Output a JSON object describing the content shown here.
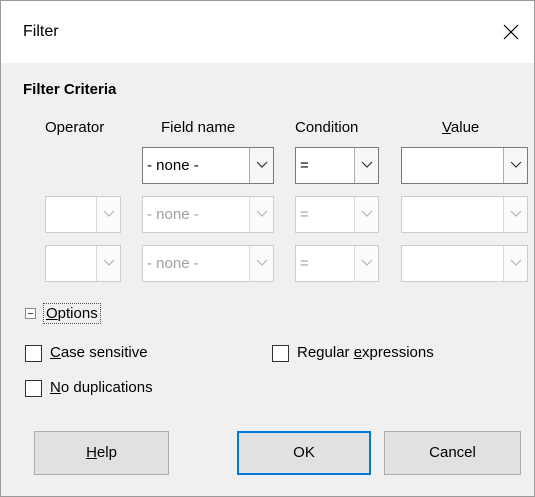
{
  "dialog": {
    "title": "Filter"
  },
  "criteria": {
    "section_title": "Filter Criteria",
    "headers": {
      "operator": "Operator",
      "field_name": "Field name",
      "condition": "Condition",
      "value_prefix": "",
      "value_mnemonic": "V",
      "value_rest": "alue"
    },
    "rows": [
      {
        "operator": "",
        "field": "- none -",
        "condition": "=",
        "value": "",
        "enabled": true,
        "operator_visible": false
      },
      {
        "operator": "",
        "field": "- none -",
        "condition": "=",
        "value": "",
        "enabled": false,
        "operator_visible": true
      },
      {
        "operator": "",
        "field": "- none -",
        "condition": "=",
        "value": "",
        "enabled": false,
        "operator_visible": true
      }
    ]
  },
  "options": {
    "expander_label_mnemonic": "O",
    "expander_label_rest": "ptions",
    "case_sensitive": {
      "mnemonic": "C",
      "rest": "ase sensitive",
      "checked": false
    },
    "regular_expressions": {
      "prefix": "Regular ",
      "mnemonic": "e",
      "rest": "xpressions",
      "checked": false
    },
    "no_duplications": {
      "mnemonic": "N",
      "rest": "o duplications",
      "checked": false
    }
  },
  "buttons": {
    "help": {
      "mnemonic": "H",
      "rest": "elp"
    },
    "ok": "OK",
    "cancel": "Cancel"
  },
  "colors": {
    "default_button_border": "#0078d7",
    "disabled_text": "#a0a0a0",
    "titlebar": "#ffffff",
    "dialog_bg": "#f0f0f0"
  }
}
